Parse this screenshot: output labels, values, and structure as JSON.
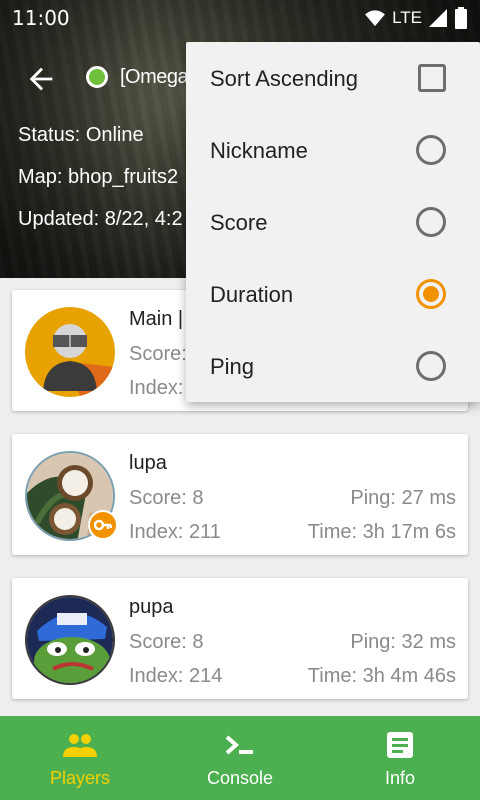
{
  "status_bar": {
    "time": "11:00",
    "network": "LTE"
  },
  "header": {
    "server_name": "[Omega-Pe",
    "status_line": "Status: Online",
    "map_line": "Map: bhop_fruits2",
    "updated_line": "Updated: 8/22, 4:2"
  },
  "players": [
    {
      "name": "Main |",
      "score": "Score:",
      "index": "Index:",
      "ping": "",
      "time": "",
      "admin": false,
      "avatar": "silhouette"
    },
    {
      "name": "lupa",
      "score": "Score: 8",
      "index": "Index: 211",
      "ping": "Ping: 27 ms",
      "time": "Time: 3h 17m 6s",
      "admin": true,
      "avatar": "coconut"
    },
    {
      "name": "pupa",
      "score": "Score: 8",
      "index": "Index: 214",
      "ping": "Ping: 32 ms",
      "time": "Time: 3h 4m 46s",
      "admin": false,
      "avatar": "frog"
    }
  ],
  "sort_menu": {
    "sort_ascending_label": "Sort Ascending",
    "sort_ascending_checked": false,
    "options": [
      {
        "label": "Nickname",
        "selected": false
      },
      {
        "label": "Score",
        "selected": false
      },
      {
        "label": "Duration",
        "selected": true
      },
      {
        "label": "Ping",
        "selected": false
      }
    ]
  },
  "bottom_nav": {
    "items": [
      {
        "label": "Players",
        "icon": "people-icon",
        "active": true
      },
      {
        "label": "Console",
        "icon": "terminal-icon",
        "active": false
      },
      {
        "label": "Info",
        "icon": "document-icon",
        "active": false
      }
    ]
  },
  "colors": {
    "accent": "#f39200",
    "nav_green": "#4caf50",
    "online_green": "#6fbf3b",
    "active_nav_text": "#f5d000"
  }
}
